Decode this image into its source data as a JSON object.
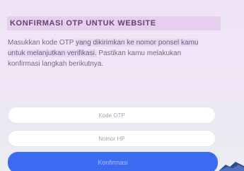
{
  "hero": {
    "title": "KONFIRMASI OTP UNTUK WEBSITE",
    "description_parts": [
      "Masukkan kode OTP ",
      "yang dikirimkan ke nomor ponsel kamu untuk melanjutkan verifikasi.",
      " Pastikan kamu melakukan konfirmasi langkah berikutnya."
    ]
  },
  "form": {
    "field_one_placeholder": "Kode OTP",
    "field_two_placeholder": "Nomor HP",
    "submit_label": "Konfirmasi"
  },
  "colors": {
    "accent": "#3b6bf0",
    "title_bg": "#e7cdee",
    "text": "#7a6687"
  }
}
